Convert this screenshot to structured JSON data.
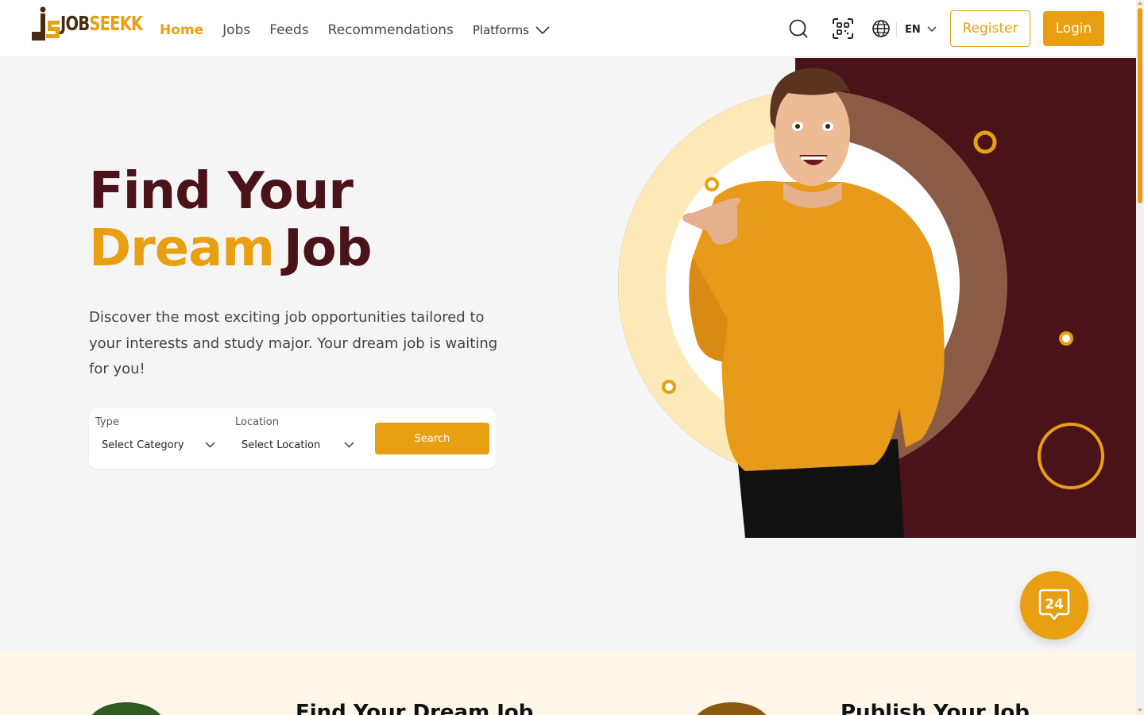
{
  "brand": {
    "logo_part1": "JOB",
    "logo_part2": "SEEKK",
    "primary_color": "#e8a012",
    "dark_color": "#4a1219"
  },
  "nav": {
    "home": "Home",
    "jobs": "Jobs",
    "feeds": "Feeds",
    "recommendations": "Recommendations",
    "platforms": "Platforms"
  },
  "header": {
    "language": "EN",
    "register_label": "Register",
    "login_label": "Login"
  },
  "hero": {
    "title_line1": "Find Your",
    "title_accent": "Dream",
    "title_rest": "Job",
    "description": "Discover the most exciting job opportunities tailored to your interests and study major. Your dream job is waiting for you!"
  },
  "search": {
    "type_label": "Type",
    "type_value": "Select Category",
    "location_label": "Location",
    "location_value": "Select Location",
    "button_label": "Search"
  },
  "support": {
    "badge": "24"
  },
  "sections": {
    "find_title": "Find Your Dream Job",
    "publish_title": "Publish Your Job"
  }
}
